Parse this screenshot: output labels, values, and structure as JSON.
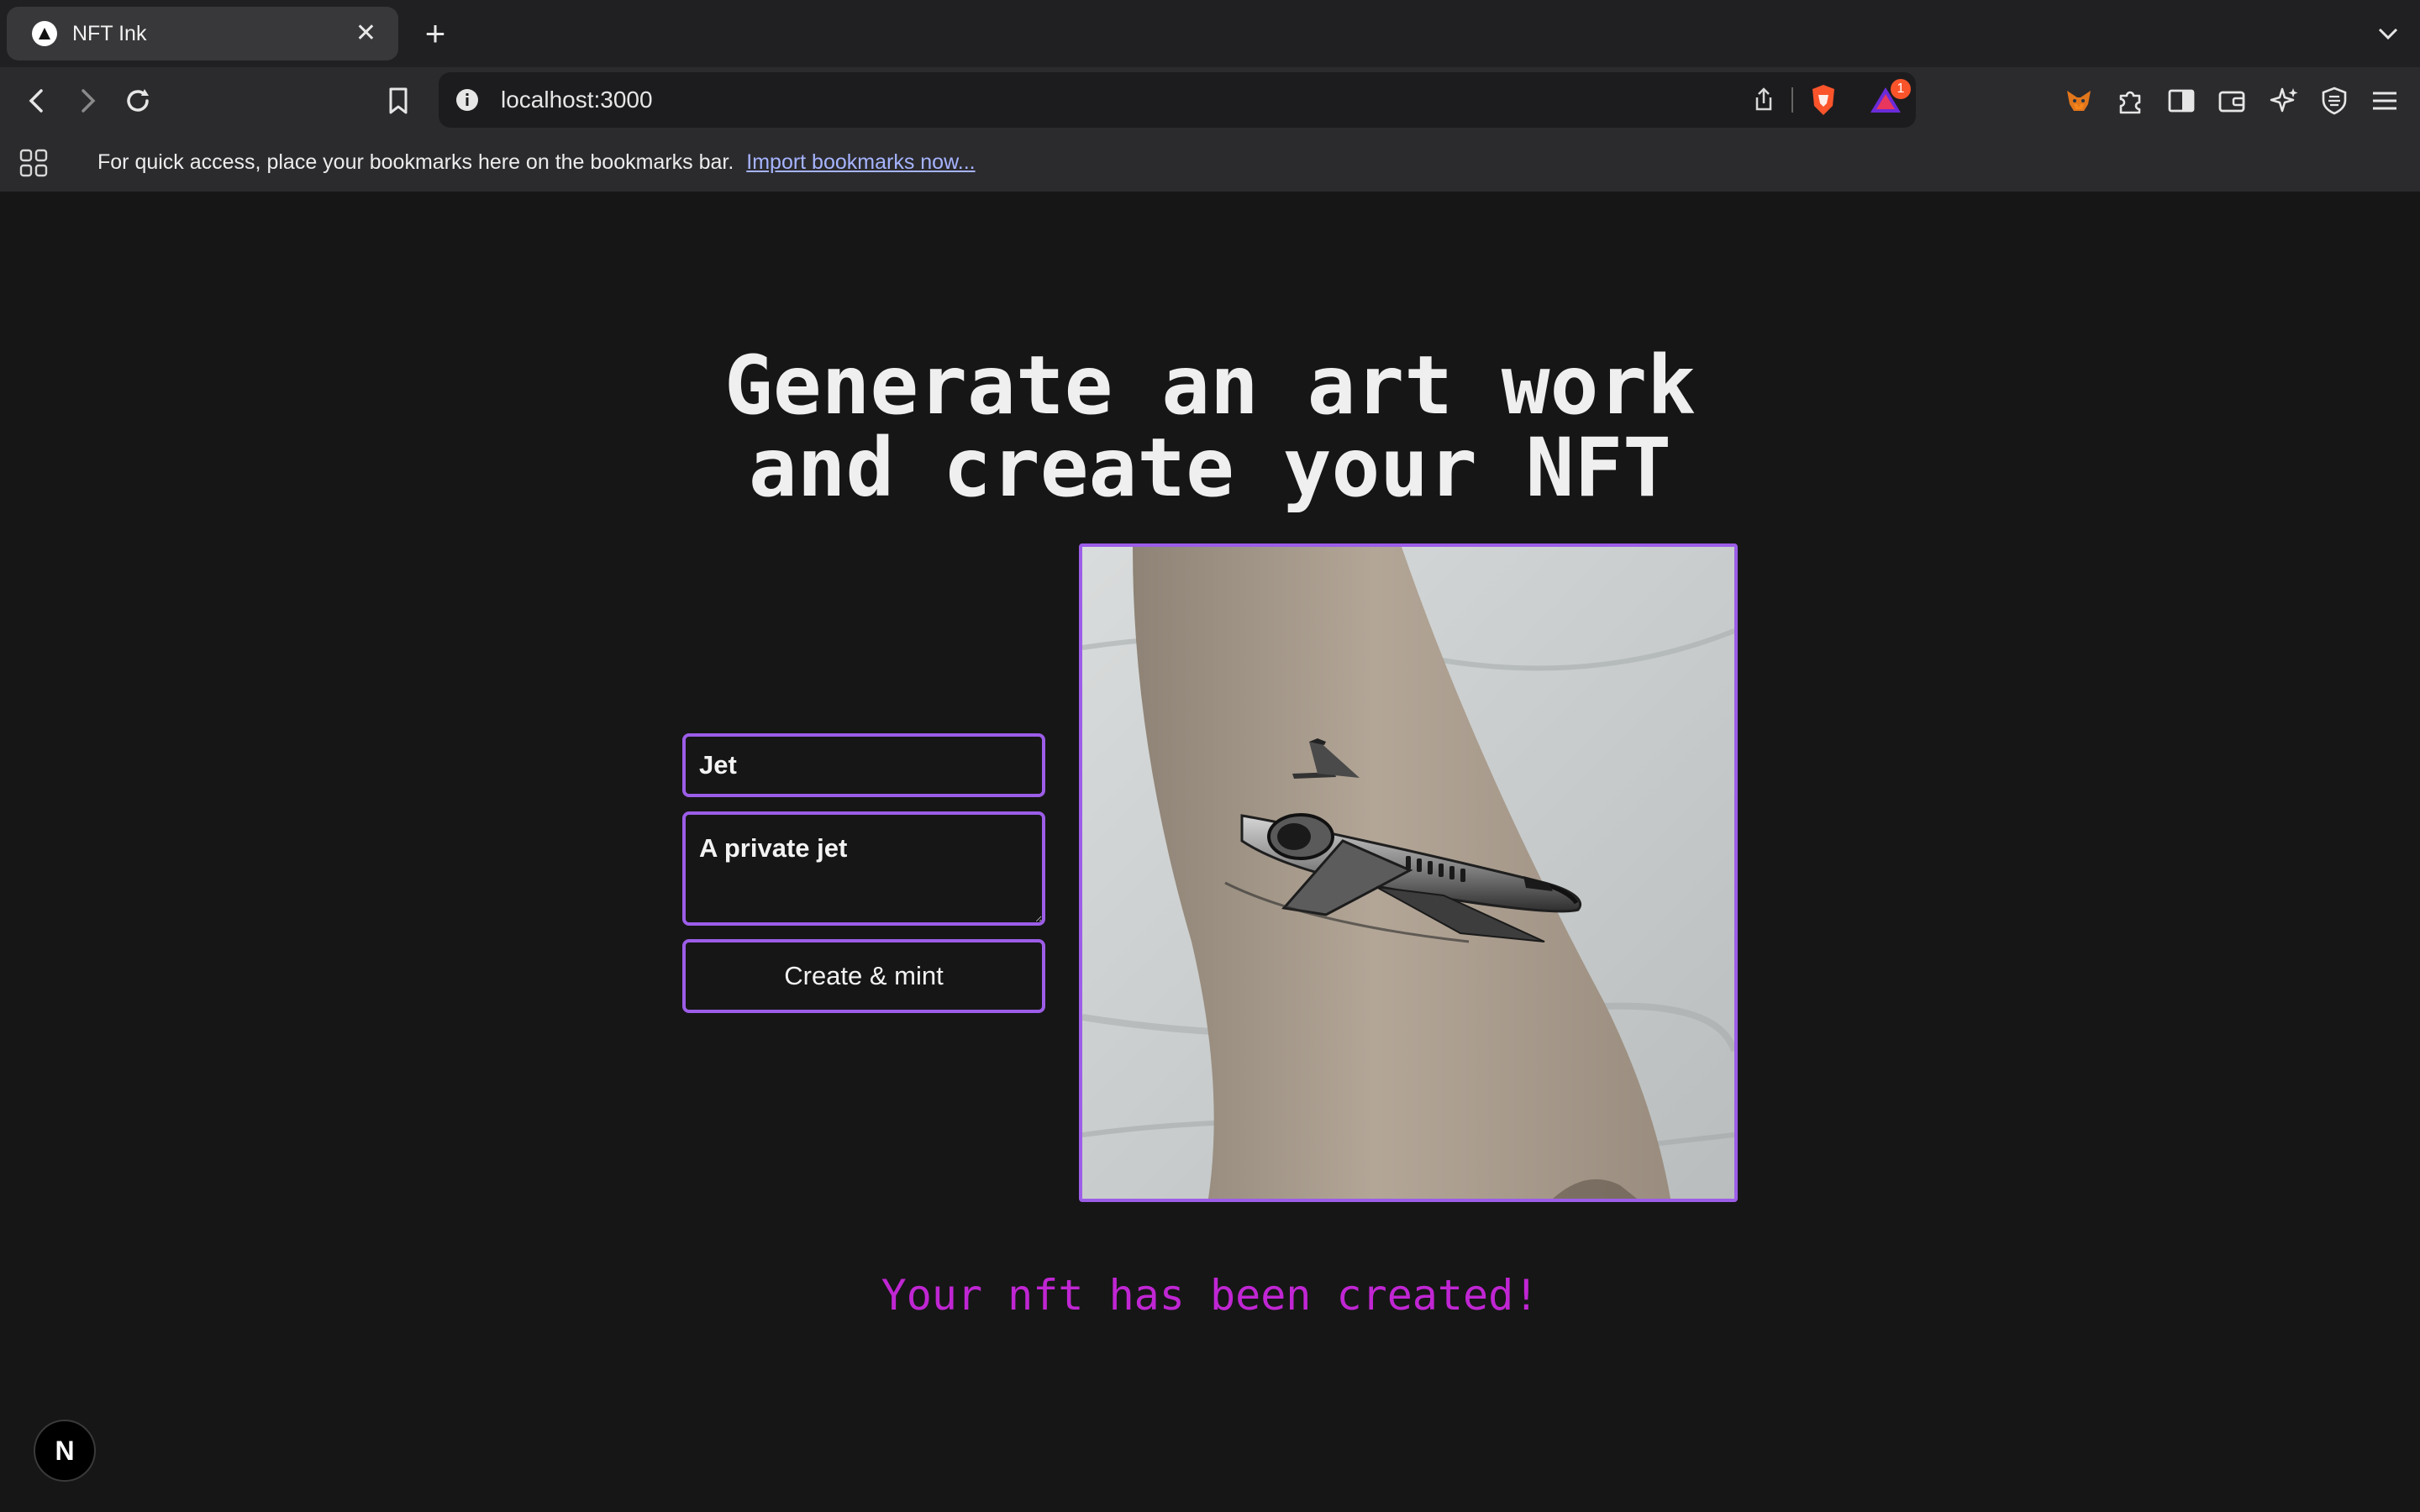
{
  "browser": {
    "tab": {
      "title": "NFT Ink"
    },
    "url": "localhost:3000",
    "notification_count": "1",
    "bookmarks_bar": {
      "message": "For quick access, place your bookmarks here on the bookmarks bar.",
      "import_link": "Import bookmarks now..."
    },
    "icons": [
      "back-icon",
      "forward-icon",
      "reload-icon",
      "bookmark-icon",
      "info-icon",
      "share-icon",
      "brave-shields-icon",
      "brave-rewards-icon",
      "metamask-icon",
      "extensions-icon",
      "sidebar-icon",
      "wallet-icon",
      "leo-ai-icon",
      "vpn-icon",
      "menu-icon",
      "apps-icon"
    ]
  },
  "page": {
    "headline_line1": "Generate an art work",
    "headline_line2": "and create your NFT",
    "form": {
      "name_value": "Jet",
      "description_value": "A private jet",
      "submit_label": "Create & mint"
    },
    "status_message": "Your nft has been created!",
    "dev_badge": "N"
  },
  "colors": {
    "accent": "#9c5de8",
    "status": "#c026d3",
    "background": "#161616"
  }
}
